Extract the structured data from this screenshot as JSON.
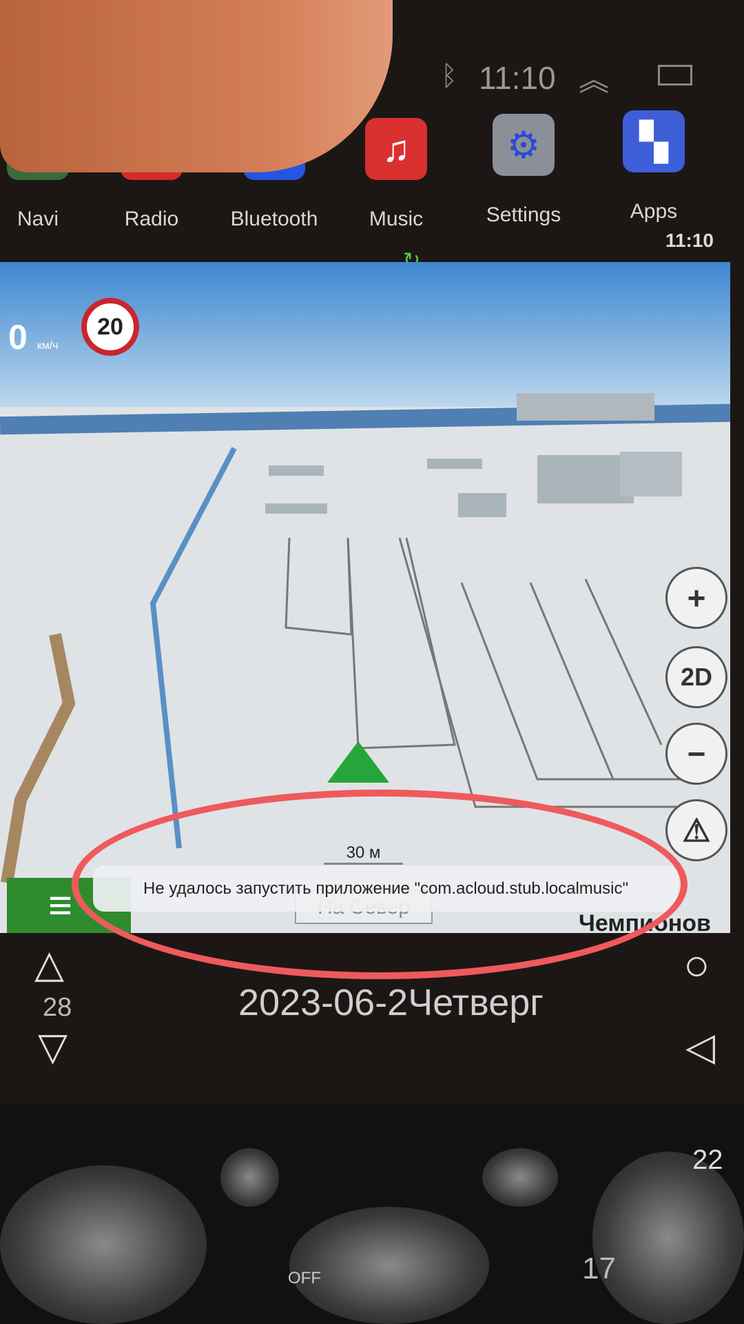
{
  "status_bar": {
    "time": "11:10",
    "icons": [
      "bluetooth-icon",
      "chevron-up-double-icon",
      "window-icon"
    ]
  },
  "apps": [
    {
      "label": "Navi",
      "icon": "map-pin-icon",
      "color": "#3a6b3a"
    },
    {
      "label": "Radio",
      "icon": "radio-icon",
      "color": "#d62a2a"
    },
    {
      "label": "Bluetooth",
      "icon": "bluetooth-icon",
      "color": "#2456e0"
    },
    {
      "label": "Music",
      "icon": "music-note-icon",
      "color": "#d93030"
    },
    {
      "label": "Settings",
      "icon": "gear-icon",
      "color": "#8a8f98"
    },
    {
      "label": "Apps",
      "icon": "grid-icon",
      "color": "#3e5ed8"
    }
  ],
  "widget_clock": "11:10",
  "map": {
    "speed_value": "0",
    "speed_unit": "км/ч",
    "speed_limit": "20",
    "zoom_in": "+",
    "view_mode": "2D",
    "zoom_out": "−",
    "warning": "⚠",
    "scale": "30 м",
    "north_button": "На Север",
    "street": "Чемпионов",
    "menu_icon": "≡"
  },
  "toast": "Не удалось запустить приложение \"com.acloud.stub.localmusic\"",
  "nav": {
    "volume": "28",
    "up": "△",
    "down": "▽",
    "home": "○",
    "back": "◁",
    "date": "2023-06-2Четверг"
  },
  "dash": {
    "temp_right_top": "22",
    "temp_right_bottom": "17",
    "fan_off": "OFF"
  },
  "annotation_color": "#ef5a5c"
}
